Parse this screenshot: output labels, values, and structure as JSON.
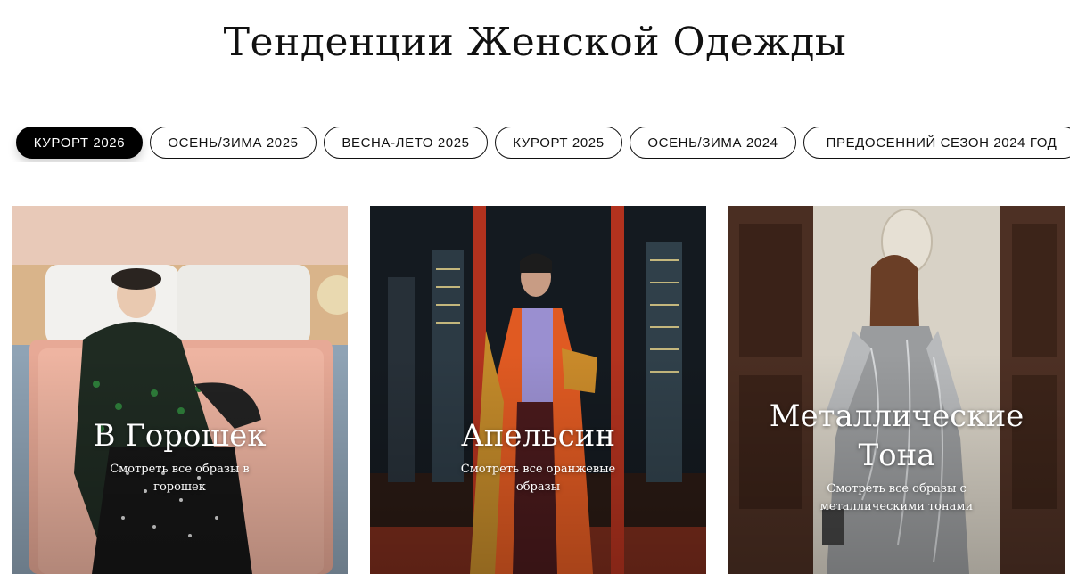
{
  "page": {
    "title": "Тенденции Женской Одежды"
  },
  "tabs": [
    {
      "label": "КУРОРТ 2026",
      "active": true
    },
    {
      "label": "ОСЕНЬ/ЗИМА 2025",
      "active": false
    },
    {
      "label": "ВЕСНА-ЛЕТО 2025",
      "active": false
    },
    {
      "label": "КУРОРТ 2025",
      "active": false
    },
    {
      "label": "ОСЕНЬ/ЗИМА 2024",
      "active": false
    },
    {
      "label": "ПРЕДОСЕННИЙ СЕЗОН 2024 ГОД",
      "active": false
    }
  ],
  "cards": [
    {
      "title": "В Горошек",
      "subtitle": "Смотреть все образы в горошек"
    },
    {
      "title": "Апельсин",
      "subtitle": "Смотреть все оранжевые образы"
    },
    {
      "title": "Металлические Тона",
      "subtitle": "Смотреть все образы с металлическими тонами"
    }
  ],
  "colors": {
    "accent": "#000000",
    "background": "#ffffff",
    "text": "#111111"
  }
}
